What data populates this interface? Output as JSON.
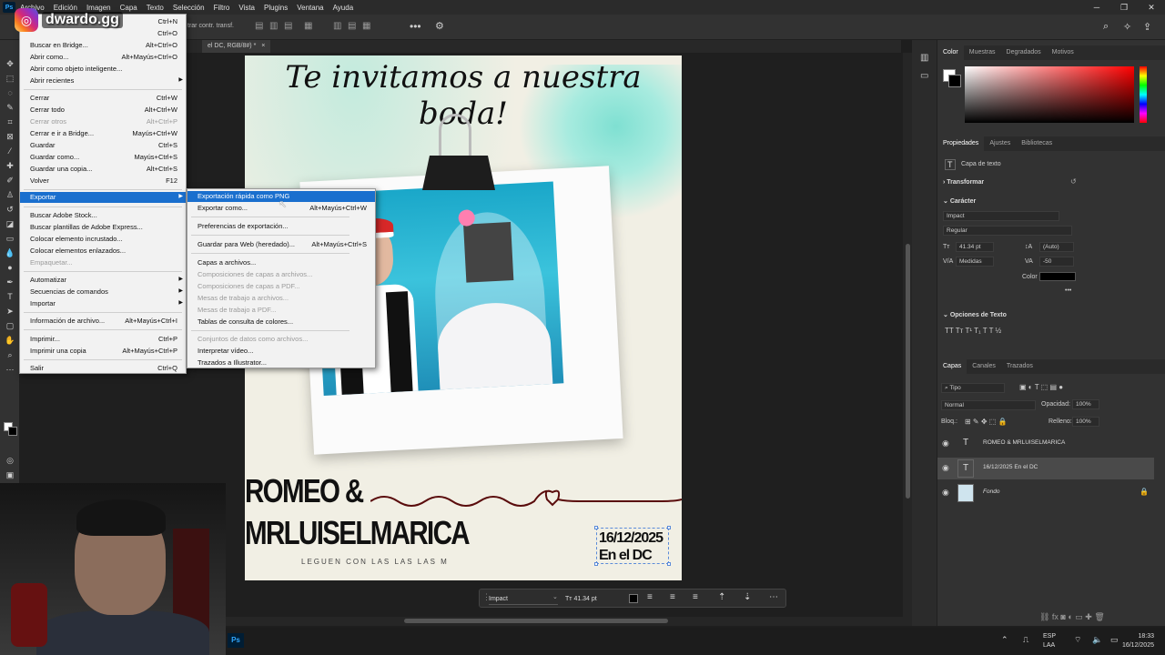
{
  "menubar": {
    "items": [
      "Archivo",
      "Edición",
      "Imagen",
      "Capa",
      "Texto",
      "Selección",
      "Filtro",
      "Vista",
      "Plugins",
      "Ventana",
      "Ayuda"
    ]
  },
  "options": {
    "transform_label": "trar contr. transf."
  },
  "document_tab": {
    "label": "el DC, RGB/8#) *"
  },
  "watermark": {
    "text": "dwardo.gg"
  },
  "file_menu": {
    "items": [
      {
        "label": "",
        "shortcut": "Ctrl+N"
      },
      {
        "label": "",
        "shortcut": "Ctrl+O"
      },
      {
        "label": "Buscar en Bridge...",
        "shortcut": "Alt+Ctrl+O"
      },
      {
        "label": "Abrir como...",
        "shortcut": "Alt+Mayús+Ctrl+O"
      },
      {
        "label": "Abrir como objeto inteligente...",
        "shortcut": ""
      },
      {
        "label": "Abrir recientes",
        "shortcut": ""
      },
      {
        "label": "Cerrar",
        "shortcut": "Ctrl+W"
      },
      {
        "label": "Cerrar todo",
        "shortcut": "Alt+Ctrl+W"
      },
      {
        "label": "Cerrar otros",
        "shortcut": "Alt+Ctrl+P"
      },
      {
        "label": "Cerrar e ir a Bridge...",
        "shortcut": "Mayús+Ctrl+W"
      },
      {
        "label": "Guardar",
        "shortcut": "Ctrl+S"
      },
      {
        "label": "Guardar como...",
        "shortcut": "Mayús+Ctrl+S"
      },
      {
        "label": "Guardar una copia...",
        "shortcut": "Alt+Ctrl+S"
      },
      {
        "label": "Volver",
        "shortcut": "F12"
      },
      {
        "label": "Exportar",
        "shortcut": ""
      },
      {
        "label": "Buscar Adobe Stock...",
        "shortcut": ""
      },
      {
        "label": "Buscar plantillas de Adobe Express...",
        "shortcut": ""
      },
      {
        "label": "Colocar elemento incrustado...",
        "shortcut": ""
      },
      {
        "label": "Colocar elementos enlazados...",
        "shortcut": ""
      },
      {
        "label": "Empaquetar...",
        "shortcut": ""
      },
      {
        "label": "Automatizar",
        "shortcut": ""
      },
      {
        "label": "Secuencias de comandos",
        "shortcut": ""
      },
      {
        "label": "Importar",
        "shortcut": ""
      },
      {
        "label": "Información de archivo...",
        "shortcut": "Alt+Mayús+Ctrl+I"
      },
      {
        "label": "Imprimir...",
        "shortcut": "Ctrl+P"
      },
      {
        "label": "Imprimir una copia",
        "shortcut": "Alt+Mayús+Ctrl+P"
      },
      {
        "label": "Salir",
        "shortcut": "Ctrl+Q"
      }
    ]
  },
  "export_submenu": {
    "items": [
      {
        "label": "Exportación rápida como PNG",
        "shortcut": ""
      },
      {
        "label": "Exportar como...",
        "shortcut": "Alt+Mayús+Ctrl+W"
      },
      {
        "label": "Preferencias de exportación...",
        "shortcut": ""
      },
      {
        "label": "Guardar para Web (heredado)...",
        "shortcut": "Alt+Mayús+Ctrl+S"
      },
      {
        "label": "Capas a archivos...",
        "shortcut": ""
      },
      {
        "label": "Composiciones de capas a archivos...",
        "shortcut": ""
      },
      {
        "label": "Composiciones de capas a PDF...",
        "shortcut": ""
      },
      {
        "label": "Mesas de trabajo a archivos...",
        "shortcut": ""
      },
      {
        "label": "Mesas de trabajo a PDF...",
        "shortcut": ""
      },
      {
        "label": "Tablas de consulta de colores...",
        "shortcut": ""
      },
      {
        "label": "Conjuntos de datos como archivos...",
        "shortcut": ""
      },
      {
        "label": "Interpretar vídeo...",
        "shortcut": ""
      },
      {
        "label": "Trazados a Illustrator...",
        "shortcut": ""
      }
    ]
  },
  "canvas": {
    "invite": "Te invitamos a nuestra boda!",
    "names_line1": "ROMEO &",
    "names_line2": "MRLUISELMARICA",
    "footer_text": "LEGUEN CON LAS   LAS LAS M",
    "date_line1": "16/12/2025",
    "date_line2": "En el DC"
  },
  "text_toolbar": {
    "font": "Impact",
    "size": "41.34 pt"
  },
  "color_panel": {
    "tabs": [
      "Color",
      "Muestras",
      "Degradados",
      "Motivos"
    ]
  },
  "properties_panel": {
    "tabs": [
      "Propiedades",
      "Ajustes",
      "Bibliotecas"
    ],
    "layer_type": "Capa de texto",
    "transform_label": "Transformar",
    "character_label": "Carácter",
    "font": "Impact",
    "style": "Regular",
    "size": "41.34 pt",
    "leading": "(Auto)",
    "kerning": "Medidas",
    "tracking": "-50",
    "color_label": "Color",
    "text_options_label": "Opciones de Texto"
  },
  "layers_panel": {
    "tabs": [
      "Capas",
      "Canales",
      "Trazados"
    ],
    "filter": "Tipo",
    "blend_mode": "Normal",
    "opacity_label": "Opacidad:",
    "opacity": "100%",
    "lock_label": "Bloq.:",
    "fill_label": "Relleno:",
    "fill": "100%",
    "layers": [
      {
        "name": "ROMEO & MRLUISELMARICA",
        "kind": "T"
      },
      {
        "name": "16/12/2025 En el DC",
        "kind": "T"
      },
      {
        "name": "Fondo",
        "kind": "img"
      }
    ]
  },
  "taskbar": {
    "lang1": "ESP",
    "lang2": "LAA",
    "time": "18:33",
    "date": "16/12/2025"
  }
}
